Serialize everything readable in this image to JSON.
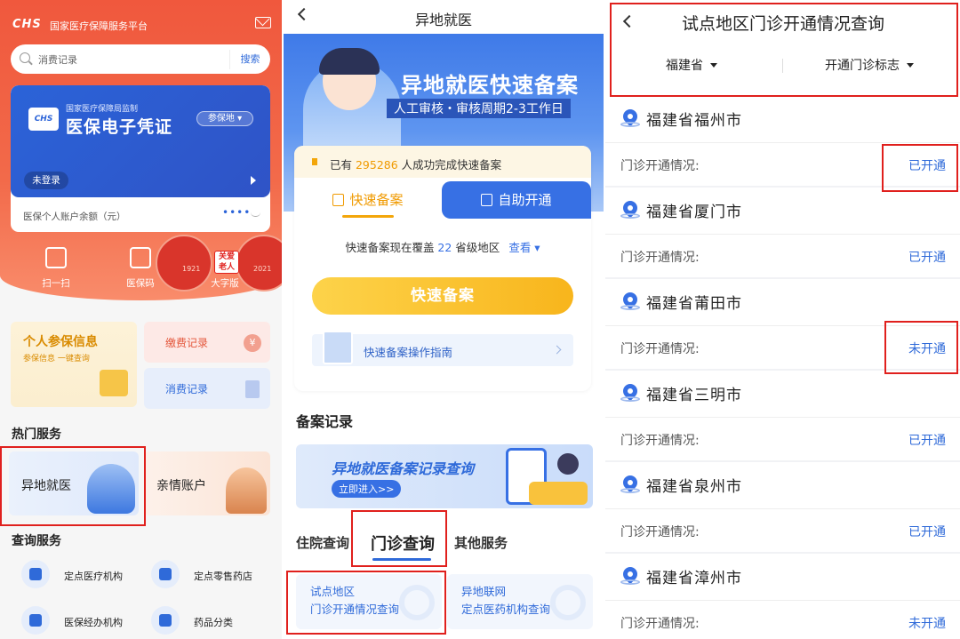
{
  "panel1": {
    "logo": "CHS",
    "platform": "国家医疗保障服务平台",
    "search": {
      "placeholder": "消费记录",
      "button": "搜索"
    },
    "card": {
      "logo_text": "CHS",
      "supervisor": "国家医疗保障局监制",
      "title": "医保电子凭证",
      "region": "参保地 ▾",
      "login": "未登录",
      "balance_label": "医保个人账户余额（元）",
      "balance_mask": "••••"
    },
    "quick_actions": [
      {
        "label": "扫一扫",
        "icon": "scan-icon"
      },
      {
        "label": "医保码",
        "icon": "qrcode-icon"
      },
      {
        "label": "大字版",
        "icon": "large-font-icon"
      }
    ],
    "decoration": {
      "badge": "关爱老人",
      "year_left": "1921",
      "year_right": "2021"
    },
    "tiles": {
      "info_title": "个人参保信息",
      "info_sub": "参保信息 一键查询",
      "pay": "缴费记录",
      "spend": "消费记录",
      "yen": "¥"
    },
    "hot_services_title": "热门服务",
    "hot_services": [
      "异地就医",
      "亲情账户"
    ],
    "query_title": "查询服务",
    "query_items": [
      {
        "label": "定点医疗机构",
        "icon": "hospital-icon"
      },
      {
        "label": "定点零售药店",
        "icon": "pill-icon"
      },
      {
        "label": "医保经办机构",
        "icon": "office-icon"
      },
      {
        "label": "药品分类",
        "icon": "list-icon"
      }
    ]
  },
  "panel2": {
    "title": "异地就医",
    "banner": {
      "headline": "异地就医快速备案",
      "sub": "人工审核・审核周期2-3工作日"
    },
    "notice": {
      "prefix": "已有 ",
      "count": "295286",
      "suffix": " 人成功完成快速备案"
    },
    "tabs": [
      "快速备案",
      "自助开通"
    ],
    "coverage": {
      "prefix": "快速备案现在覆盖 ",
      "count": "22",
      "suffix": " 省级地区",
      "link": "查看 ▾"
    },
    "primary_button": "快速备案",
    "guide": "快速备案操作指南",
    "records_title": "备案记录",
    "records_banner": {
      "title": "异地就医备案记录查询",
      "cta": "立即进入>>"
    },
    "query_tabs": [
      "住院查询",
      "门诊查询",
      "其他服务"
    ],
    "options": [
      {
        "line1": "试点地区",
        "line2": "门诊开通情况查询"
      },
      {
        "line1": "异地联网",
        "line2": "定点医药机构查询"
      }
    ]
  },
  "panel3": {
    "title": "试点地区门诊开通情况查询",
    "filters": [
      "福建省",
      "开通门诊标志"
    ],
    "status_label": "门诊开通情况:",
    "cities": [
      {
        "name": "福建省福州市",
        "status": "已开通"
      },
      {
        "name": "福建省厦门市",
        "status": "已开通"
      },
      {
        "name": "福建省莆田市",
        "status": "未开通"
      },
      {
        "name": "福建省三明市",
        "status": "已开通"
      },
      {
        "name": "福建省泉州市",
        "status": "已开通"
      },
      {
        "name": "福建省漳州市",
        "status": "未开通"
      }
    ]
  },
  "colors": {
    "accent_red": "#f0583d",
    "accent_blue": "#2f6ad9",
    "highlight_box": "#e0201d",
    "accent_yellow": "#f8b51c"
  }
}
